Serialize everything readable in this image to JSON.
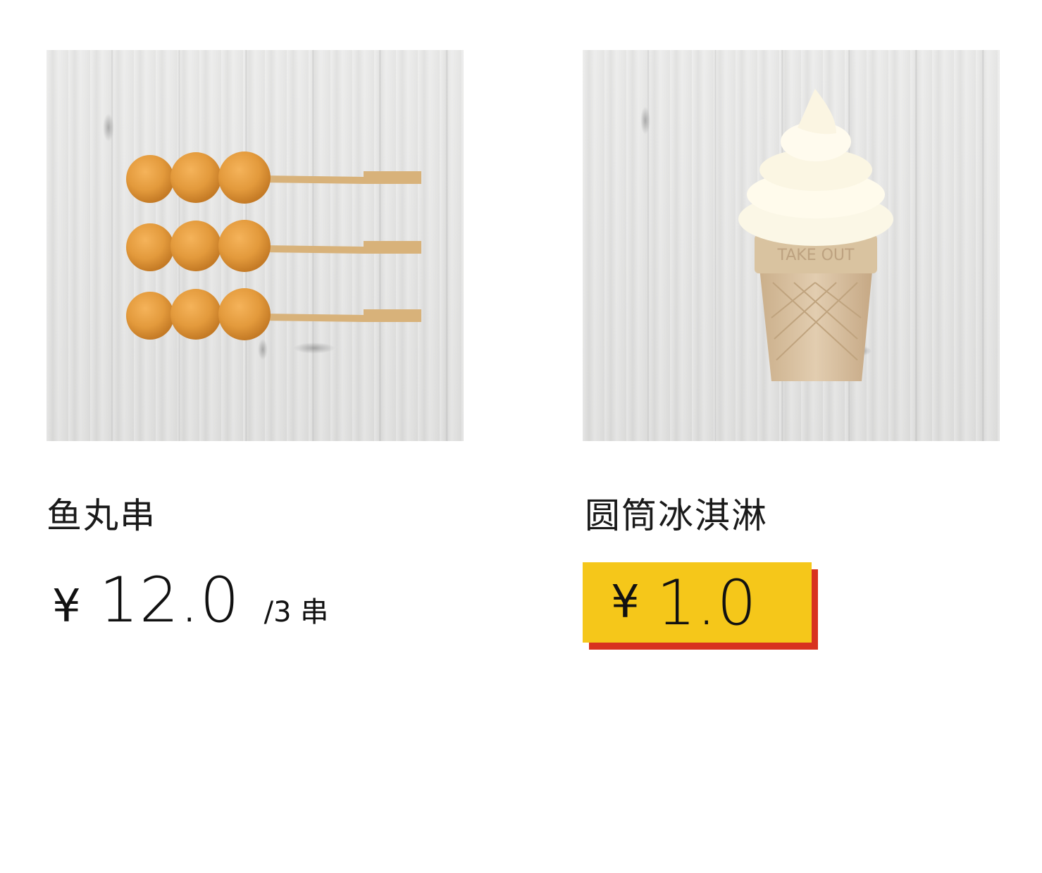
{
  "products": [
    {
      "name": "鱼丸串",
      "currency": "¥",
      "price": "12.0",
      "unit": "/3 串",
      "image": "fish-ball-skewers-image"
    },
    {
      "name": "圆筒冰淇淋",
      "currency": "¥",
      "price": "1.0",
      "image": "ice-cream-cone-image",
      "tag_colors": {
        "face": "#f5c71a",
        "shadow": "#d8321f"
      }
    }
  ]
}
